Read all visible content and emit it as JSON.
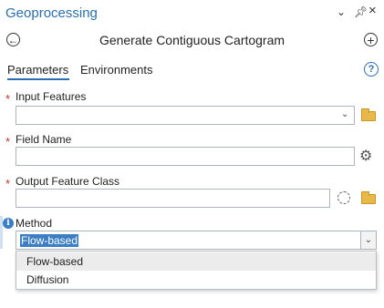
{
  "header": {
    "pane_title": "Geoprocessing",
    "icons": [
      "chevron-down-icon",
      "pin-icon",
      "close-icon"
    ]
  },
  "tool": {
    "title": "Generate Contiguous Cartogram",
    "back_icon": "back-arrow-icon",
    "add_icon": "add-icon"
  },
  "tabs": [
    {
      "label": "Parameters",
      "active": true
    },
    {
      "label": "Environments",
      "active": false
    }
  ],
  "help_symbol": "?",
  "params": [
    {
      "label": "Input Features",
      "required": true,
      "value": ""
    },
    {
      "label": "Field Name",
      "required": true,
      "value": ""
    },
    {
      "label": "Output Feature Class",
      "required": true,
      "value": ""
    },
    {
      "label": "Method",
      "required": false,
      "value": "Flow-based"
    }
  ],
  "required_marker": "*",
  "method_options": [
    "Flow-based",
    "Diffusion"
  ],
  "colors": {
    "accent": "#2a6eb3",
    "required": "#c0392b",
    "selection": "#3b7ec6"
  }
}
